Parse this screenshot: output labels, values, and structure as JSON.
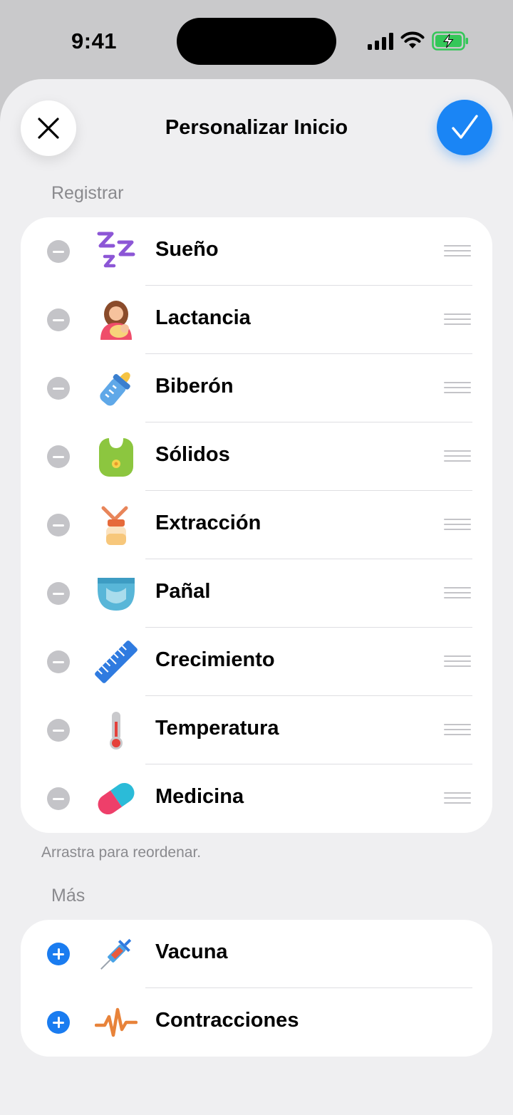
{
  "status": {
    "time": "9:41"
  },
  "header": {
    "title": "Personalizar Inicio"
  },
  "registrar": {
    "label": "Registrar",
    "items": [
      {
        "label": "Sueño",
        "icon": "sleep-icon"
      },
      {
        "label": "Lactancia",
        "icon": "breastfeeding-icon"
      },
      {
        "label": "Biberón",
        "icon": "baby-bottle-icon"
      },
      {
        "label": "Sólidos",
        "icon": "bib-icon"
      },
      {
        "label": "Extracción",
        "icon": "breast-pump-icon"
      },
      {
        "label": "Pañal",
        "icon": "diaper-icon"
      },
      {
        "label": "Crecimiento",
        "icon": "ruler-icon"
      },
      {
        "label": "Temperatura",
        "icon": "thermometer-icon"
      },
      {
        "label": "Medicina",
        "icon": "pill-icon"
      }
    ],
    "footer": "Arrastra para reordenar."
  },
  "mas": {
    "label": "Más",
    "items": [
      {
        "label": "Vacuna",
        "icon": "syringe-icon"
      },
      {
        "label": "Contracciones",
        "icon": "contractions-icon"
      }
    ]
  },
  "colors": {
    "accent": "#1a85f5",
    "background": "#efeff1",
    "card": "#ffffff"
  }
}
